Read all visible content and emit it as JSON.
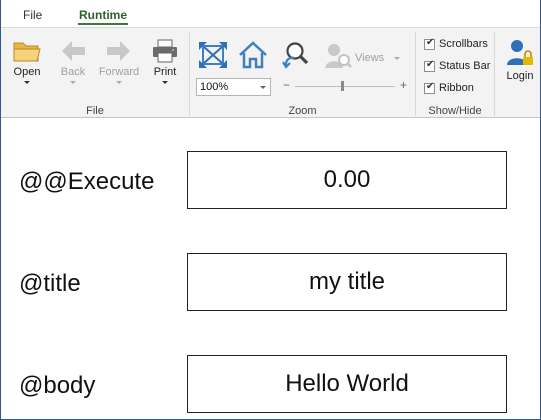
{
  "tabs": [
    {
      "label": "File"
    },
    {
      "label": "Runtime"
    }
  ],
  "ribbon": {
    "file_group": {
      "label": "File",
      "open": "Open",
      "back": "Back",
      "forward": "Forward",
      "print": "Print"
    },
    "zoom_group": {
      "label": "Zoom",
      "zoom_value": "100%",
      "zoom_minus": "−",
      "zoom_plus": "+",
      "views": "Views"
    },
    "showhide_group": {
      "label": "Show/Hide",
      "scrollbars": "Scrollbars",
      "status_bar": "Status Bar",
      "ribbon": "Ribbon"
    },
    "login": "Login"
  },
  "params": [
    {
      "label": "@@Execute",
      "value": "0.00"
    },
    {
      "label": "@title",
      "value": "my title"
    },
    {
      "label": "@body",
      "value": "Hello World"
    }
  ]
}
